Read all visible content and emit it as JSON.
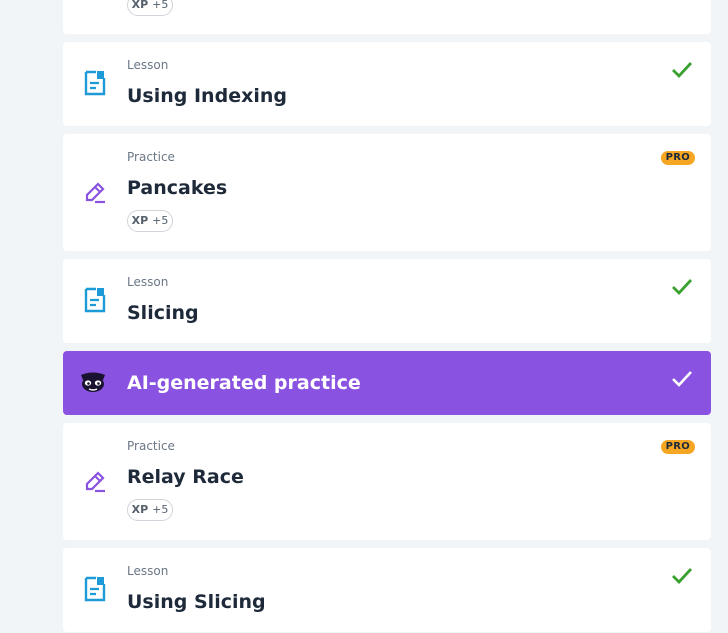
{
  "colors": {
    "lesson_icon": "#1d9bd8",
    "practice_icon": "#8a52e0",
    "check": "#3aa02f",
    "ai_background": "#8a52e0",
    "pro_badge": "#f5a623"
  },
  "partial_item": {
    "xp_label": "XP",
    "xp_value": "+5"
  },
  "items": [
    {
      "kind": "Lesson",
      "title": "Using Indexing",
      "icon": "lesson-icon",
      "completed": true
    },
    {
      "kind": "Practice",
      "title": "Pancakes",
      "icon": "pencil-icon",
      "pro": "PRO",
      "xp_label": "XP",
      "xp_value": "+5"
    },
    {
      "kind": "Lesson",
      "title": "Slicing",
      "icon": "lesson-icon",
      "completed": true
    },
    {
      "kind": "",
      "title": "AI-generated practice",
      "icon": "ai-mascot-icon",
      "completed": true
    },
    {
      "kind": "Practice",
      "title": "Relay Race",
      "icon": "pencil-icon",
      "pro": "PRO",
      "xp_label": "XP",
      "xp_value": "+5"
    },
    {
      "kind": "Lesson",
      "title": "Using Slicing",
      "icon": "lesson-icon",
      "completed": true
    }
  ]
}
